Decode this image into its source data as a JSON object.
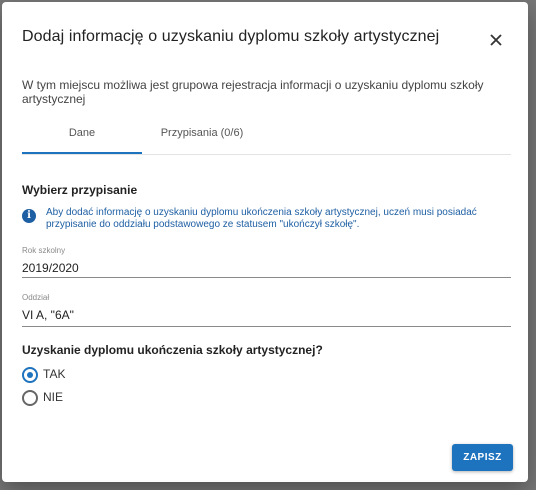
{
  "dialog": {
    "title": "Dodaj informację o uzyskaniu dyplomu szkoły artystycznej",
    "description": "W tym miejscu możliwa jest grupowa rejestracja informacji o uzyskaniu dyplomu szkoły artystycznej",
    "close_icon": "close-icon"
  },
  "tabs": [
    {
      "label": "Dane",
      "active": true
    },
    {
      "label": "Przypisania (0/6)",
      "active": false
    }
  ],
  "section": {
    "title": "Wybierz przypisanie",
    "info_icon": "info-icon",
    "info_text": "Aby dodać informację o uzyskaniu dyplomu ukończenia szkoły artystycznej, uczeń musi posiadać przypisanie do oddziału podstawowego ze statusem \"ukończył szkołę\"."
  },
  "fields": {
    "rok": {
      "label": "Rok szkolny",
      "value": "2019/2020"
    },
    "oddzial": {
      "label": "Oddział",
      "value": "VI A, \"6A\""
    }
  },
  "question": {
    "label": "Uzyskanie dyplomu ukończenia szkoły artystycznej?",
    "options": [
      {
        "label": "TAK",
        "selected": true
      },
      {
        "label": "NIE",
        "selected": false
      }
    ]
  },
  "actions": {
    "save_label": "ZAPISZ"
  },
  "colors": {
    "accent": "#1e73be",
    "info": "#1e5fa3"
  }
}
